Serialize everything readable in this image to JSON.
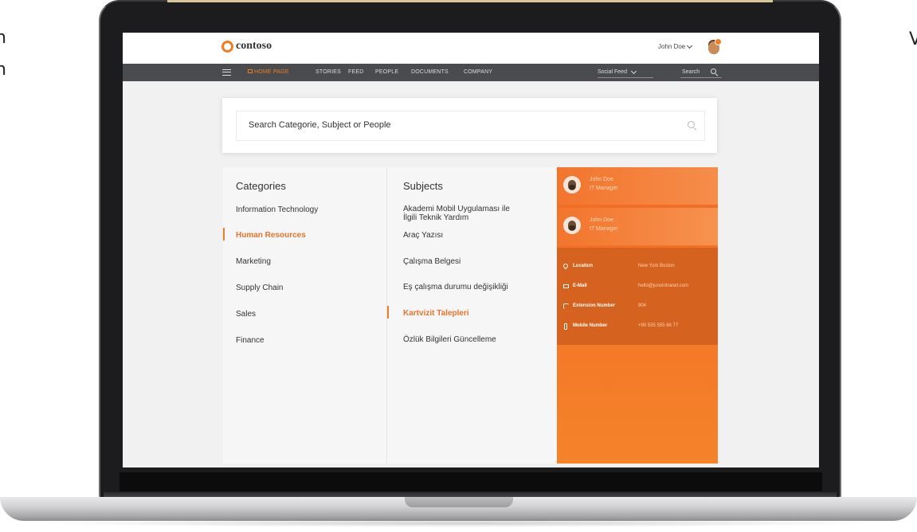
{
  "side_text": {
    "left_lines": [
      "n",
      "n"
    ],
    "right_lines": [
      "V"
    ]
  },
  "header": {
    "logo_text": "contoso",
    "user_name": "John Doe",
    "avatar_icon": "user-avatar-icon"
  },
  "nav": {
    "items": [
      {
        "label": "HOME PAGE",
        "active": true
      },
      {
        "label": "STORIES"
      },
      {
        "label": "FEED"
      },
      {
        "label": "PEOPLE"
      },
      {
        "label": "DOCUMENTS"
      },
      {
        "label": "COMPANY"
      }
    ],
    "feed_select": "Social Feed",
    "search_label": "Search"
  },
  "search": {
    "placeholder": "Search Categorie, Subject or People"
  },
  "categories": {
    "title": "Categories",
    "items": [
      {
        "label": "Information Technology"
      },
      {
        "label": "Human Resources",
        "active": true
      },
      {
        "label": "Marketing"
      },
      {
        "label": "Supply Chain"
      },
      {
        "label": "Sales"
      },
      {
        "label": "Finance"
      }
    ]
  },
  "subjects": {
    "title": "Subjects",
    "items": [
      {
        "label": "Akademi Mobil Uygulaması ile\nİlgili Teknik Yardım"
      },
      {
        "label": "Araç Yazısı"
      },
      {
        "label": "Çalışma Belgesi"
      },
      {
        "label": "Eş çalışma durumu değişikliği"
      },
      {
        "label": "Kartvizit Talepleri",
        "active": true
      },
      {
        "label": "Özlük Bilgileri Güncelleme"
      }
    ]
  },
  "people": [
    {
      "name": "John Doe",
      "title": "IT Manager"
    },
    {
      "name": "John Doe",
      "title": "IT Manager"
    }
  ],
  "contact": {
    "location_label": "Location",
    "location_value": "New York Boston",
    "email_label": "E-Mail",
    "email_value": "hello@junointranet.com",
    "extension_label": "Extension Number",
    "extension_value": "904",
    "mobile_label": "Mobile Number",
    "mobile_value": "+90 535 555 66 77"
  },
  "colors": {
    "accent": "#f07d22",
    "nav_bg": "#4a4b4f",
    "panel_orange": "#f26a24",
    "details_bg": "#d5621f"
  }
}
